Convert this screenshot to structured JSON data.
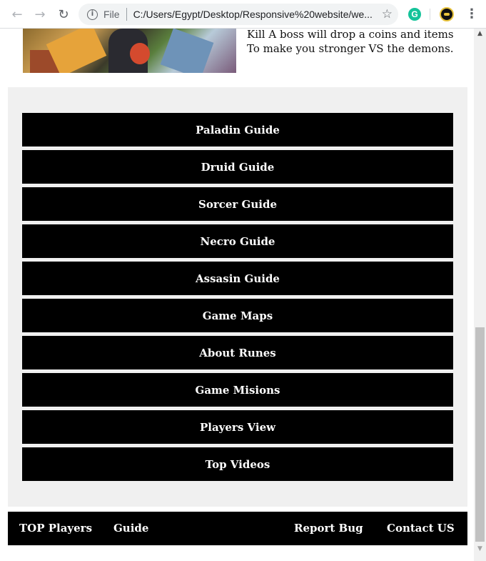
{
  "browser": {
    "scheme_label": "File",
    "url": "C:/Users/Egypt/Desktop/Responsive%20website/we...",
    "grammarly_letter": "G"
  },
  "hero": {
    "line1": "Kill A boss will drop a coins and items",
    "line2": "To make you stronger VS the demons."
  },
  "guides": [
    {
      "label": "Paladin Guide"
    },
    {
      "label": "Druid Guide"
    },
    {
      "label": "Sorcer Guide"
    },
    {
      "label": "Necro Guide"
    },
    {
      "label": "Assasin Guide"
    },
    {
      "label": "Game Maps"
    },
    {
      "label": "About Runes"
    },
    {
      "label": "Game Misions"
    },
    {
      "label": "Players View"
    },
    {
      "label": "Top Videos"
    }
  ],
  "footer": {
    "top_players": "TOP Players",
    "guide": "Guide",
    "report_bug": "Report Bug",
    "contact_us": "Contact US"
  },
  "colors": {
    "menu_background": "#000000",
    "menu_text": "#ffffff",
    "section_background": "#f0f0f0"
  }
}
